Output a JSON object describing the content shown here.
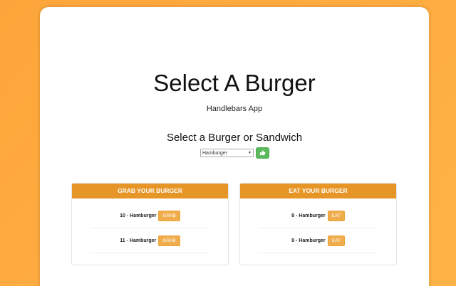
{
  "header": {
    "title": "Select A Burger",
    "subtitle": "Handlebars App"
  },
  "selector": {
    "heading": "Select a Burger or Sandwich",
    "selected_option": "Hamburger",
    "submit_icon": "thumbs-up-icon"
  },
  "grab_panel": {
    "title": "GRAB YOUR BURGER",
    "items": [
      {
        "label": "10 - Hamburger",
        "button": "GRAB"
      },
      {
        "label": "11 - Hamburger",
        "button": "GRAB"
      }
    ]
  },
  "eat_panel": {
    "title": "EAT YOUR BURGER",
    "items": [
      {
        "label": "8 - Hamburger",
        "button": "EAT"
      },
      {
        "label": "9 - Hamburger",
        "button": "EAT"
      }
    ]
  },
  "colors": {
    "background": "#fda53a",
    "panel_header": "#e69626",
    "item_button": "#f0ad4e",
    "submit_button": "#5cb85c"
  }
}
